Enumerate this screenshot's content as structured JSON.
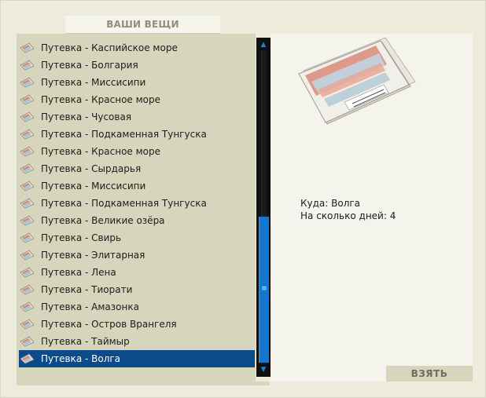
{
  "panel": {
    "title": "ВАШИ ВЕЩИ"
  },
  "items": [
    {
      "label": "Путевка - Каспийское море"
    },
    {
      "label": "Путевка - Болгария"
    },
    {
      "label": "Путевка - Миссисипи"
    },
    {
      "label": "Путевка - Красное море"
    },
    {
      "label": "Путевка - Чусовая"
    },
    {
      "label": "Путевка - Подкаменная Тунгуска"
    },
    {
      "label": "Путевка - Красное море"
    },
    {
      "label": "Путевка - Сырдарья"
    },
    {
      "label": "Путевка - Миссисипи"
    },
    {
      "label": "Путевка - Подкаменная Тунгуска"
    },
    {
      "label": "Путевка - Великие озёра"
    },
    {
      "label": "Путевка - Свирь"
    },
    {
      "label": "Путевка - Элитарная"
    },
    {
      "label": "Путевка - Лена"
    },
    {
      "label": "Путевка - Тиорати"
    },
    {
      "label": "Путевка - Амазонка"
    },
    {
      "label": "Путевка - Остров Врангеля"
    },
    {
      "label": "Путевка - Таймыр"
    },
    {
      "label": "Путевка - Волга",
      "selected": true
    }
  ],
  "details": {
    "destination_line": "Куда: Волга",
    "days_line": "На сколько дней: 4"
  },
  "actions": {
    "take_label": "ВЗЯТЬ"
  },
  "colors": {
    "selection": "#0b4b8a",
    "scroll_accent": "#1478d1",
    "list_background": "#d7d5bb"
  },
  "icons": {
    "item": "ticket-icon",
    "scroll_up": "arrow-up-icon",
    "scroll_down": "arrow-down-icon"
  }
}
